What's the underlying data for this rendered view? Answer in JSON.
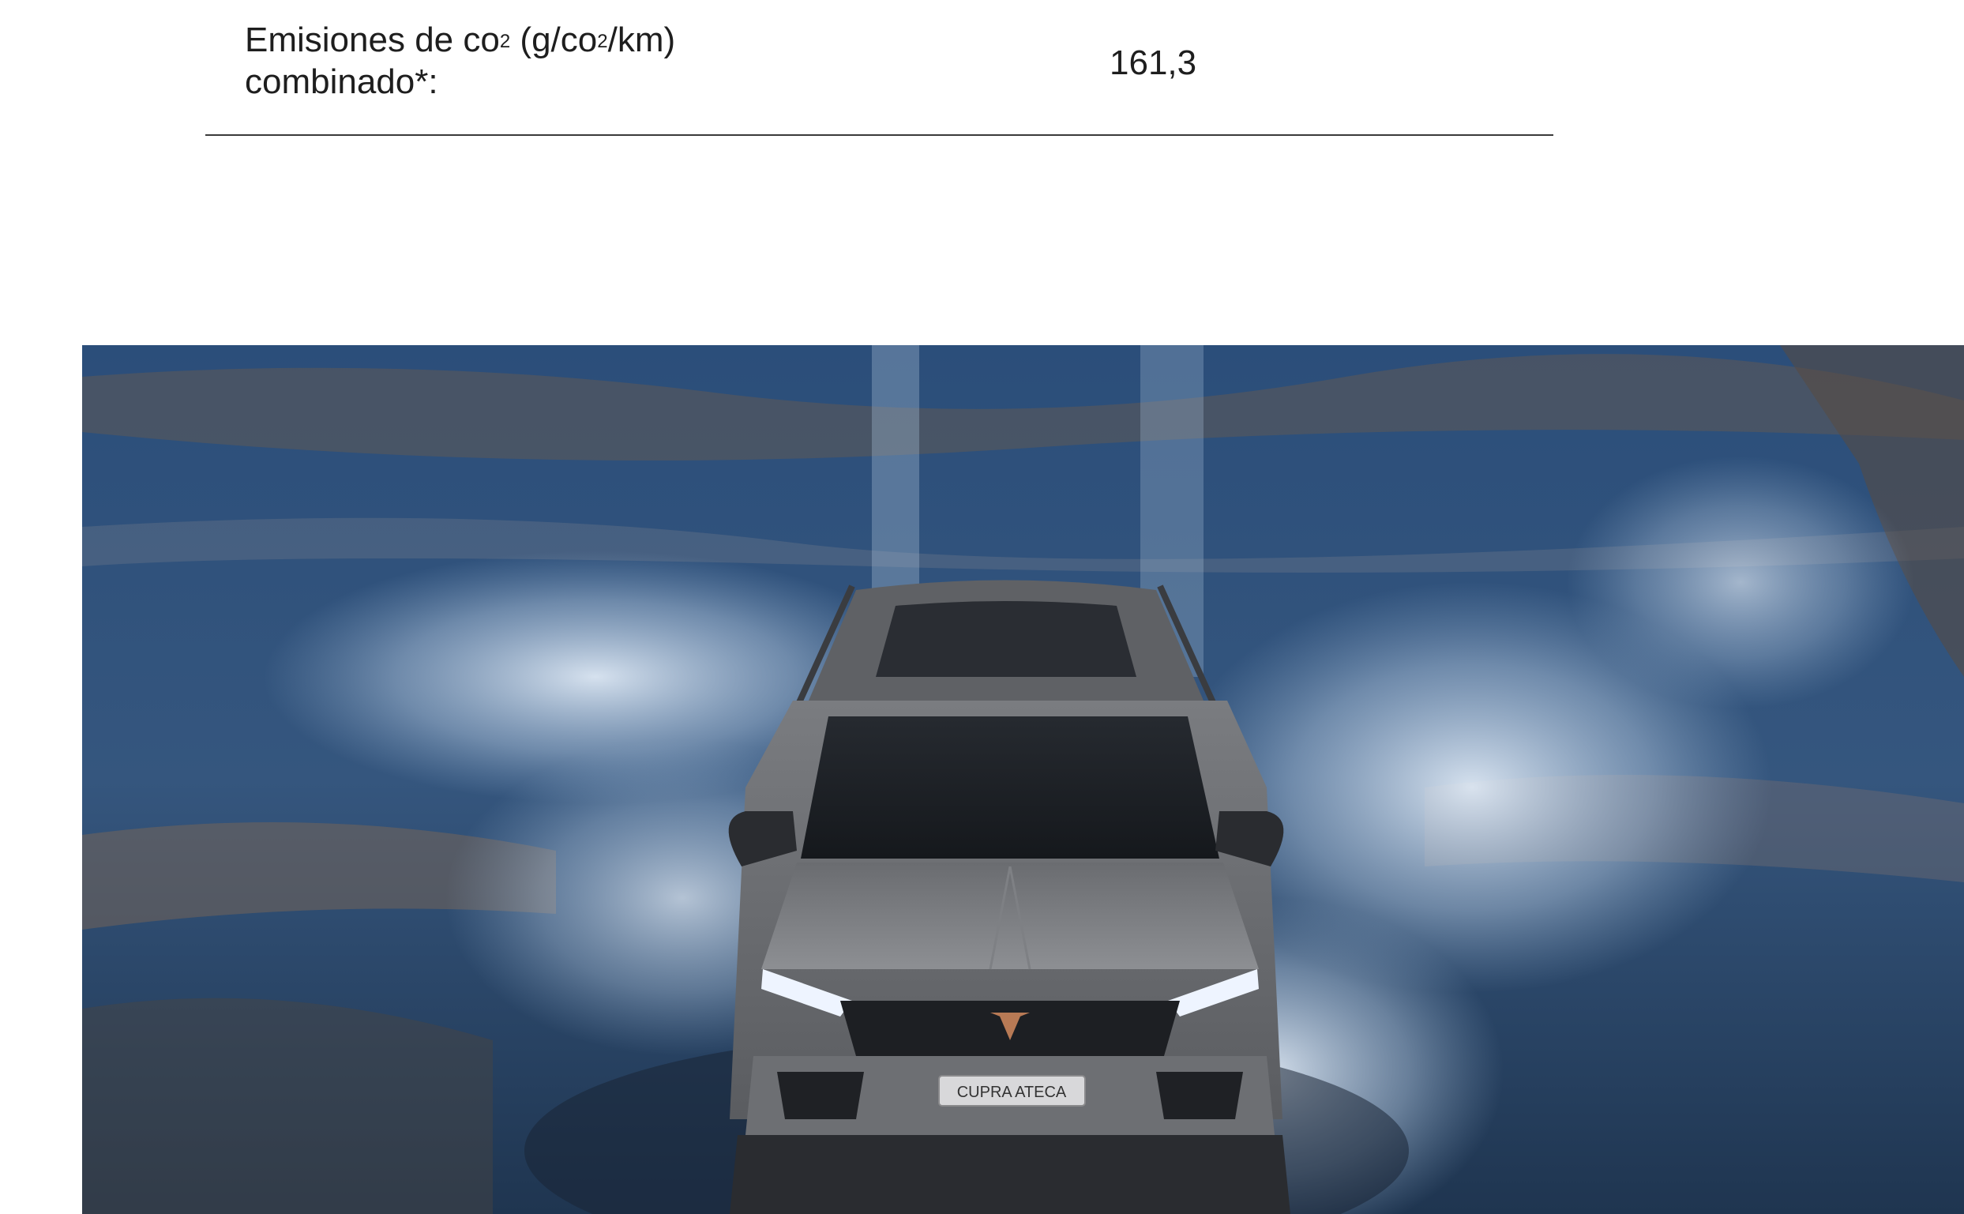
{
  "spec": {
    "label_part1": "Emisiones de co",
    "label_sup1": "2",
    "label_part2": " (g/co",
    "label_sup2": "2",
    "label_part3": "/km)",
    "label_line2": "combinado*:",
    "value": "161,3"
  },
  "photo": {
    "plate_text": "CUPRA ATECA"
  },
  "colors": {
    "divider": "#3a3a3a",
    "text": "#1e1e1e",
    "logo_copper": "#b87a55"
  }
}
